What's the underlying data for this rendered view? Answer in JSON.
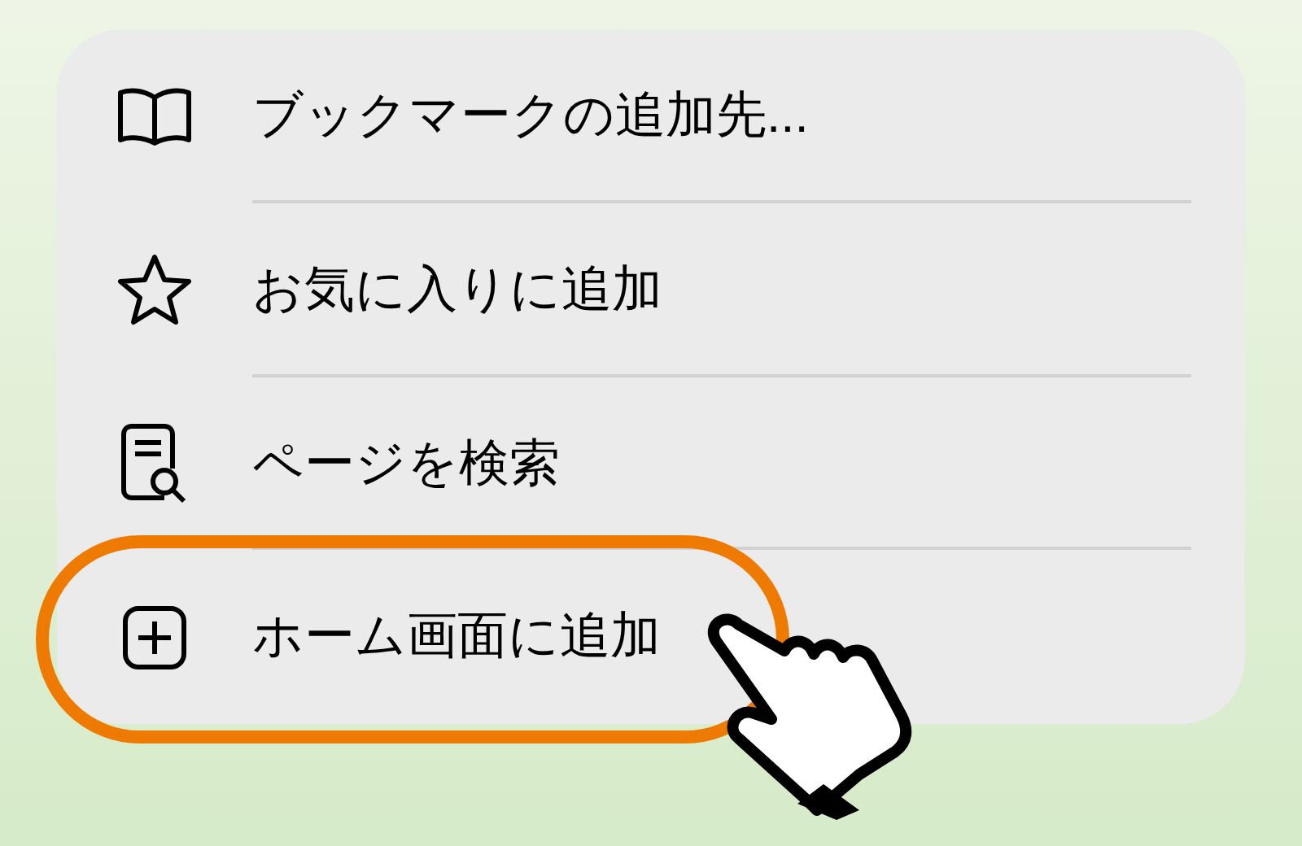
{
  "menu": {
    "items": [
      {
        "kind": "book",
        "label": "ブックマークの追加先...",
        "highlighted": false
      },
      {
        "kind": "star",
        "label": "お気に入りに追加",
        "highlighted": false
      },
      {
        "kind": "find",
        "label": "ページを検索",
        "highlighted": false
      },
      {
        "kind": "plus",
        "label": "ホーム画面に追加",
        "highlighted": true
      }
    ]
  }
}
